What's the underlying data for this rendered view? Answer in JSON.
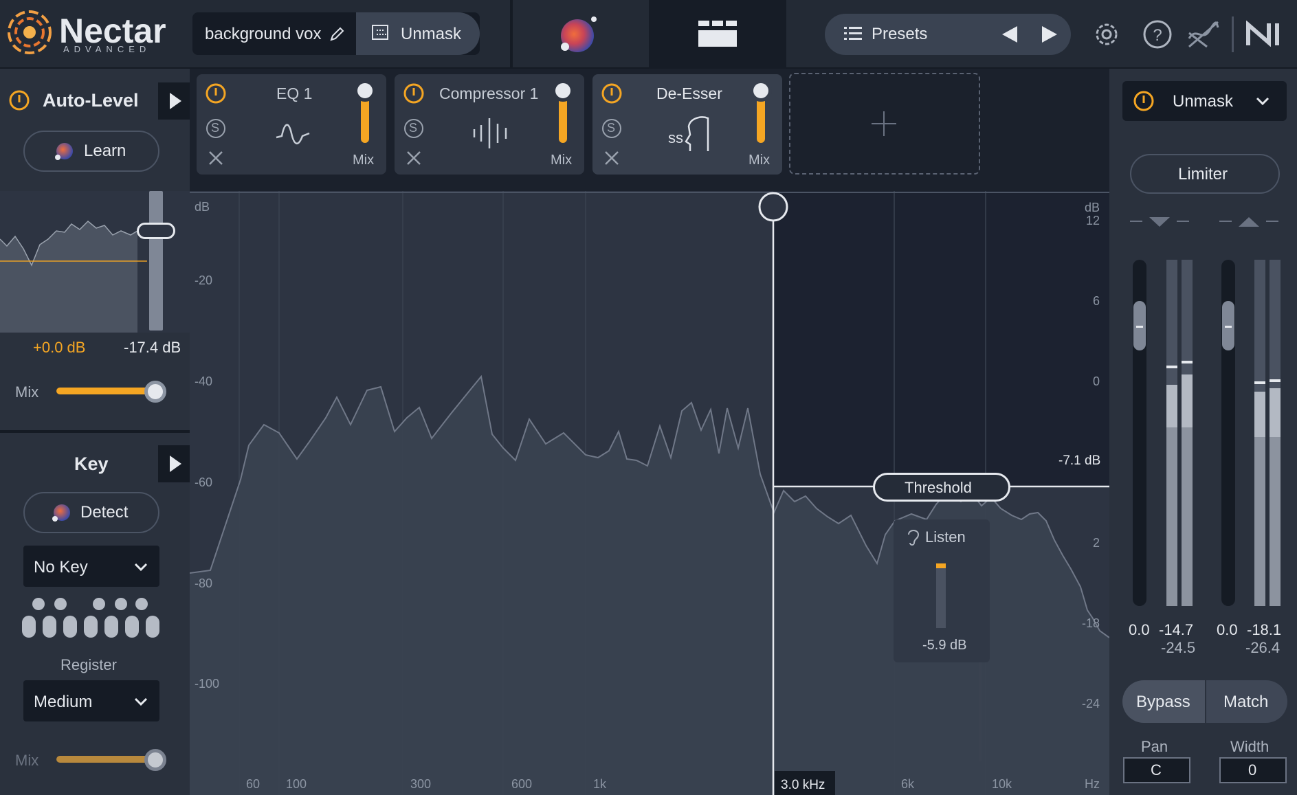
{
  "app": {
    "name": "Nectar",
    "edition": "ADVANCED"
  },
  "header": {
    "preset_name": "background vox",
    "unmask_label": "Unmask",
    "presets_label": "Presets"
  },
  "auto_level": {
    "title": "Auto-Level",
    "learn_label": "Learn",
    "gain_value": "+0.0 dB",
    "target_value": "-17.4 dB",
    "mix_label": "Mix",
    "mix_level": 0.88
  },
  "key": {
    "title": "Key",
    "detect_label": "Detect",
    "key_value": "No Key",
    "register_label": "Register",
    "register_value": "Medium",
    "mix_label": "Mix",
    "mix_level": 0.88
  },
  "modules": [
    {
      "title": "EQ 1",
      "mix_label": "Mix",
      "solo_glyph": "S"
    },
    {
      "title": "Compressor 1",
      "mix_label": "Mix",
      "solo_glyph": "S"
    },
    {
      "title": "De-Esser",
      "mix_label": "Mix",
      "solo_glyph": "S"
    }
  ],
  "spectrum": {
    "left_unit": "dB",
    "left_ticks": [
      "-20",
      "-40",
      "-60",
      "-80",
      "-100"
    ],
    "right_unit": "dB",
    "right_ticks": [
      "12",
      "6",
      "0",
      "2",
      "-18",
      "-24"
    ],
    "freq_ticks": [
      "60",
      "100",
      "300",
      "600",
      "1k",
      "6k",
      "10k",
      "Hz"
    ],
    "crossover_freq": "3.0 kHz",
    "threshold_label": "Threshold",
    "threshold_value": "-7.1 dB",
    "listen_label": "Listen",
    "listen_value": "-5.9 dB"
  },
  "right_panel": {
    "unmask_label": "Unmask",
    "limiter_label": "Limiter",
    "meters": {
      "in_peak": "0.0",
      "in_level": "-14.7",
      "in_rms": "-24.5",
      "out_peak": "0.0",
      "out_level": "-18.1",
      "out_rms": "-26.4"
    },
    "bypass_label": "Bypass",
    "match_label": "Match",
    "pan_label": "Pan",
    "pan_value": "C",
    "width_label": "Width",
    "width_value": "0"
  },
  "colors": {
    "accent": "#f5a623",
    "background": "#252c38",
    "panel": "#2a313d",
    "dark": "#151b24"
  }
}
